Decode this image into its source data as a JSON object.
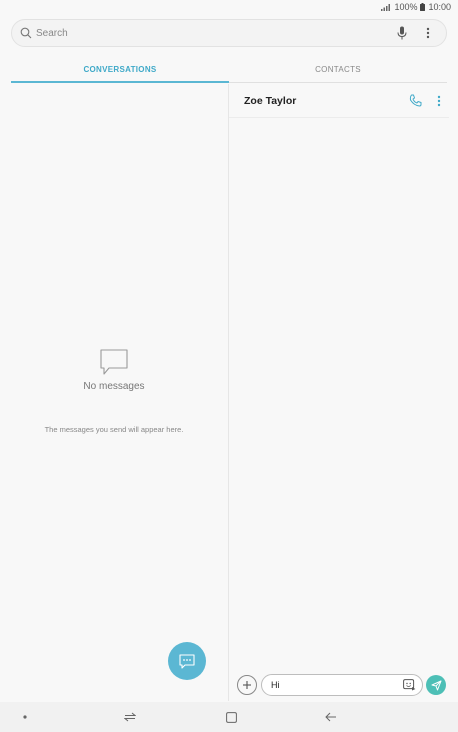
{
  "status_bar": {
    "battery": "100%",
    "time": "10:00",
    "icons": [
      "signal-icon",
      "battery-icon"
    ]
  },
  "search": {
    "placeholder": "Search",
    "icons": [
      "search-icon",
      "microphone-icon",
      "more-options-icon"
    ]
  },
  "tabs": [
    {
      "label": "CONVERSATIONS",
      "active": true
    },
    {
      "label": "CONTACTS",
      "active": false
    }
  ],
  "conversations": {
    "empty_title": "No messages",
    "empty_subtitle": "The messages you send will appear here.",
    "empty_icon": "chat-bubble-icon",
    "fab_icon": "new-message-icon"
  },
  "chat": {
    "contact_name": "Zoe Taylor",
    "header_icons": [
      "phone-icon",
      "more-options-icon"
    ],
    "composer": {
      "text": "Hi",
      "icons": [
        "add-icon",
        "sticker-icon",
        "send-icon"
      ]
    }
  },
  "nav_bar": {
    "icons": [
      "dot-icon",
      "recent-apps-icon",
      "home-icon",
      "back-icon"
    ]
  },
  "colors": {
    "accent": "#5bb7d3",
    "send": "#4dbfb6",
    "background": "#f8f8f8"
  }
}
